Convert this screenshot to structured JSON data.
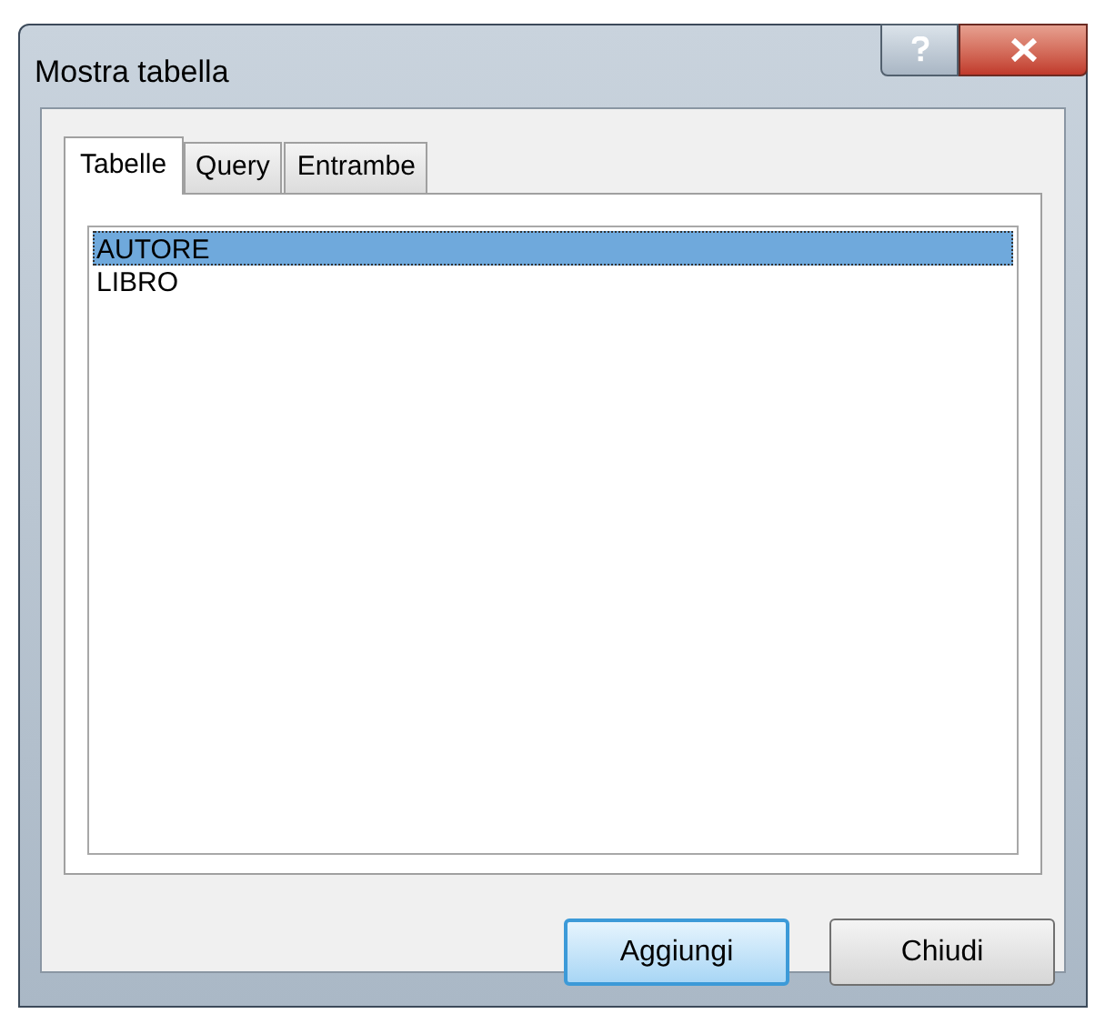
{
  "window": {
    "title": "Mostra tabella"
  },
  "tabs": [
    {
      "label": "Tabelle",
      "selected": true
    },
    {
      "label": "Query",
      "selected": false
    },
    {
      "label": "Entrambe",
      "selected": false
    }
  ],
  "list": [
    {
      "label": "AUTORE",
      "selected": true
    },
    {
      "label": "LIBRO",
      "selected": false
    }
  ],
  "buttons": [
    {
      "label": "Aggiungi",
      "default": true
    },
    {
      "label": "Chiudi",
      "default": false
    }
  ]
}
